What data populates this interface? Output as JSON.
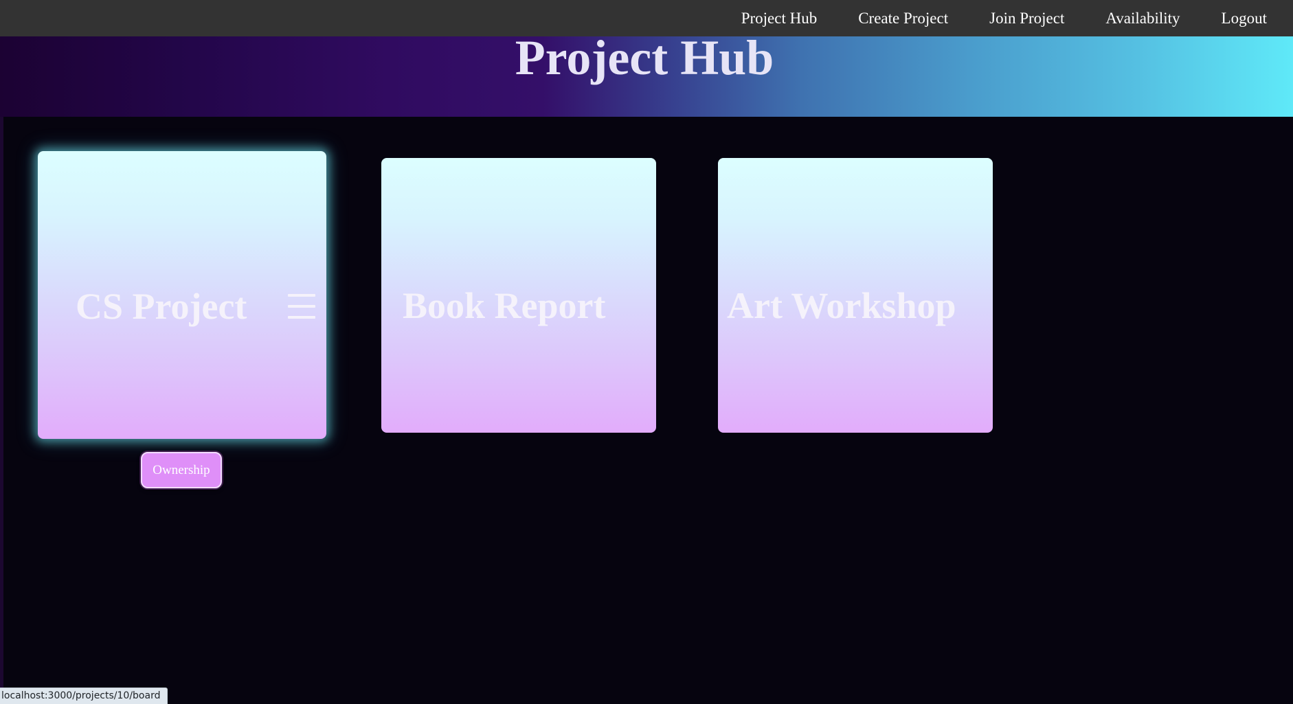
{
  "nav": {
    "items": [
      {
        "label": "Project Hub"
      },
      {
        "label": "Create Project"
      },
      {
        "label": "Join Project"
      },
      {
        "label": "Availability"
      },
      {
        "label": "Logout"
      }
    ]
  },
  "banner": {
    "title": "Project Hub"
  },
  "projects": [
    {
      "title": "CS Project",
      "menu_icon": "hamburger-menu-icon",
      "ownership_label": "Ownership"
    },
    {
      "title": "Book Report"
    },
    {
      "title": "Art Workshop"
    }
  ],
  "statusbar": {
    "url": "localhost:3000/projects/10/board"
  },
  "colors": {
    "nav_bg": "#333333",
    "page_bg": "#06040f",
    "card_top": "#dcfeff",
    "card_bottom": "#e2acfb",
    "button_bg": "#df8ff8",
    "banner_left": "#1c0233",
    "banner_right": "#5fe9f8"
  }
}
